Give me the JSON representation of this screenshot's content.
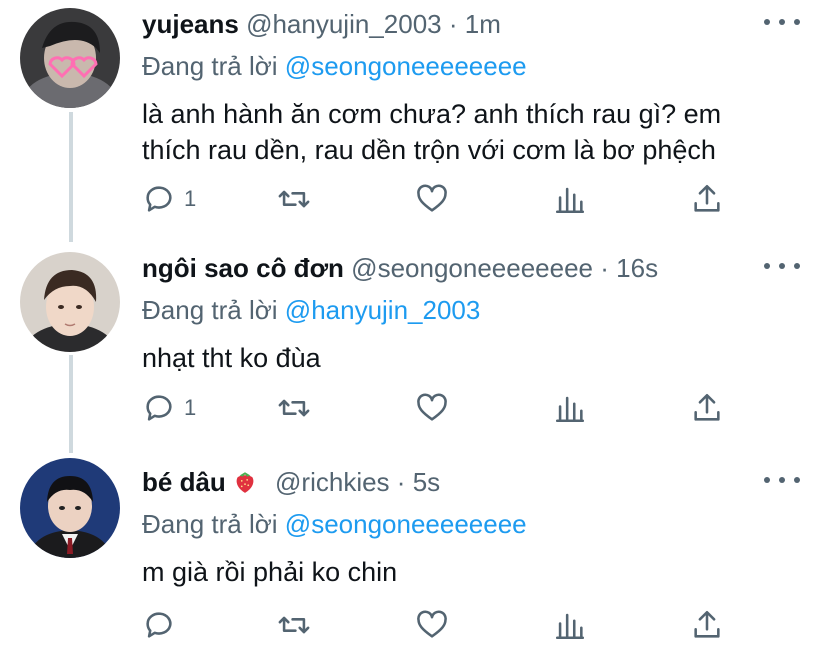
{
  "colors": {
    "link": "#1d9bf0",
    "secondary": "#536471",
    "text": "#0f1419",
    "thread": "#cfd9de"
  },
  "tweets": [
    {
      "name": "yujeans",
      "handle": "@hanyujin_2003",
      "dot": "·",
      "time": "1m",
      "reply_label": "Đang trả lời",
      "reply_to": "@seongoneeeeeeee",
      "lines": [
        "là anh hành ăn cơm chưa? anh thích rau gì? em",
        "thích rau dền, rau dền trộn với cơm là bơ phệch"
      ],
      "reply_count": "1"
    },
    {
      "name": "ngôi sao cô đơn",
      "handle": "@seongoneeeeeeee",
      "dot": "·",
      "time": "16s",
      "reply_label": "Đang trả lời",
      "reply_to": "@hanyujin_2003",
      "lines": [
        "nhạt tht ko đùa"
      ],
      "reply_count": "1"
    },
    {
      "name": "bé dâu",
      "name_emoji": "strawberry-icon",
      "handle": "@richkies",
      "dot": "·",
      "time": "5s",
      "reply_label": "Đang trả lời",
      "reply_to": "@seongoneeeeeeee",
      "lines": [
        "m già rồi phải ko chin"
      ],
      "reply_count": ""
    }
  ]
}
